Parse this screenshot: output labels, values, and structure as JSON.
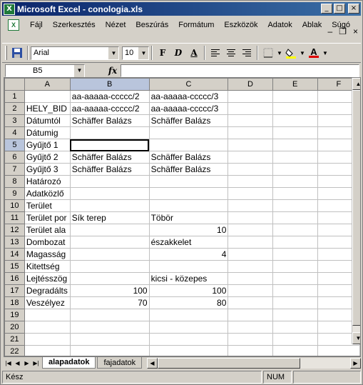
{
  "titlebar": {
    "title": "Microsoft Excel - conologia.xls",
    "app_icon": "X",
    "minimize": "_",
    "maximize": "□",
    "close": "×"
  },
  "menubar": {
    "items": [
      "Fájl",
      "Szerkesztés",
      "Nézet",
      "Beszúrás",
      "Formátum",
      "Eszközök",
      "Adatok",
      "Ablak",
      "Súgó"
    ],
    "doc_minimize": "–",
    "doc_restore": "❐",
    "doc_close": "×"
  },
  "toolbar": {
    "font": "Arial",
    "size": "10",
    "bold": "F",
    "italic": "D",
    "underline": "A",
    "font_color_label": "A"
  },
  "formula_bar": {
    "name_box": "B5",
    "fx": "fx"
  },
  "grid": {
    "columns": [
      "A",
      "B",
      "C",
      "D",
      "E",
      "F"
    ],
    "selected_cell": "B5",
    "rows": [
      {
        "n": "1",
        "a": "",
        "b": "aa-aaaaa-ccccc/2",
        "c": "aa-aaaaa-ccccc/3"
      },
      {
        "n": "2",
        "a": "HELY_BID",
        "b": "aa-aaaaa-ccccc/2",
        "c": "aa-aaaaa-ccccc/3"
      },
      {
        "n": "3",
        "a": "Dátumtól",
        "b": "Schäffer Balázs",
        "c": "Schäffer Balázs"
      },
      {
        "n": "4",
        "a": "Dátumig",
        "b": "",
        "c": ""
      },
      {
        "n": "5",
        "a": "Gyűjtő 1",
        "b": "",
        "c": ""
      },
      {
        "n": "6",
        "a": "Gyűjtő 2",
        "b": "Schäffer Balázs",
        "c": "Schäffer Balázs"
      },
      {
        "n": "7",
        "a": "Gyűjtő 3",
        "b": "Schäffer Balázs",
        "c": "Schäffer Balázs"
      },
      {
        "n": "8",
        "a": "Határozó",
        "b": "",
        "c": ""
      },
      {
        "n": "9",
        "a": "Adatközlő",
        "b": "",
        "c": ""
      },
      {
        "n": "10",
        "a": "Terület",
        "b": "",
        "c": ""
      },
      {
        "n": "11",
        "a": "Terület por",
        "b": "Sík terep",
        "c": "Töbör"
      },
      {
        "n": "12",
        "a": "Terület ala",
        "b": "",
        "c": "10",
        "c_num": true
      },
      {
        "n": "13",
        "a": "Dombozat",
        "b": "",
        "c": "északkelet"
      },
      {
        "n": "14",
        "a": "Magasság",
        "b": "",
        "c": "4",
        "c_num": true
      },
      {
        "n": "15",
        "a": "Kitettség",
        "b": "",
        "c": ""
      },
      {
        "n": "16",
        "a": "Lejtésszög",
        "b": "",
        "c": "kicsi - közepes"
      },
      {
        "n": "17",
        "a": "Degradálts",
        "b": "100",
        "c": "100",
        "b_num": true,
        "c_num": true
      },
      {
        "n": "18",
        "a": "Veszélyez",
        "b": "70",
        "c": "80",
        "b_num": true,
        "c_num": true
      },
      {
        "n": "19",
        "a": "",
        "b": "",
        "c": ""
      },
      {
        "n": "20",
        "a": "",
        "b": "",
        "c": ""
      },
      {
        "n": "21",
        "a": "",
        "b": "",
        "c": ""
      },
      {
        "n": "22",
        "a": "",
        "b": "",
        "c": ""
      }
    ]
  },
  "tabs": [
    {
      "label": "alapadatok",
      "active": true
    },
    {
      "label": "fajadatok",
      "active": false
    }
  ],
  "statusbar": {
    "left": "Kész",
    "num": "NUM"
  }
}
